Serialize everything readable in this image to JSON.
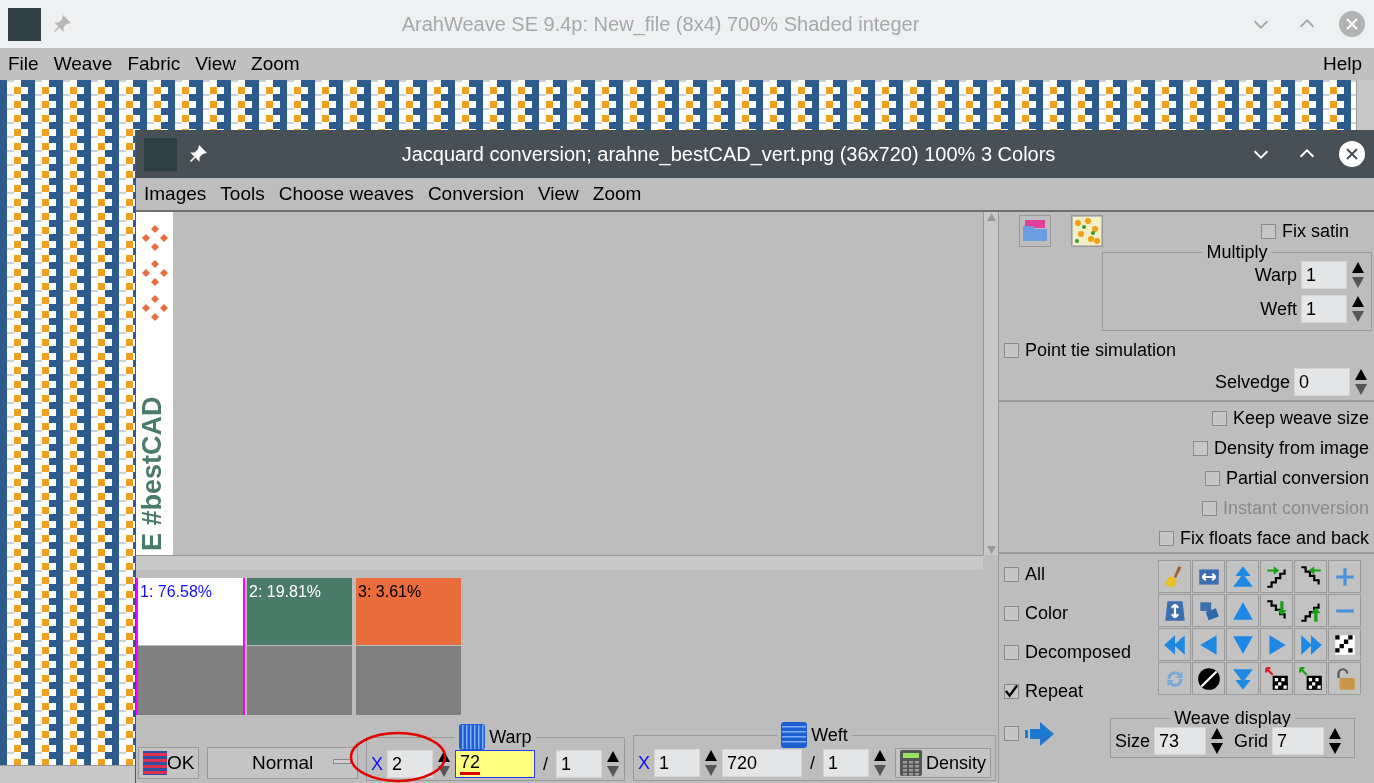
{
  "window": {
    "title": "ArahWeave SE 9.4p: New_file (8x4) 700% Shaded integer"
  },
  "menu": [
    "File",
    "Weave",
    "Fabric",
    "View",
    "Zoom"
  ],
  "help_menu": "Help",
  "dialog": {
    "title": "Jacquard conversion; arahne_bestCAD_vert.png (36x720) 100% 3 Colors",
    "menu": [
      "Images",
      "Tools",
      "Choose weaves",
      "Conversion",
      "View",
      "Zoom"
    ],
    "image_text": "E #bestCAD",
    "palette": [
      {
        "label": "1: 76.58%",
        "color": "#ffffff",
        "selected": true
      },
      {
        "label": "2: 19.81%",
        "color": "#4a7a68",
        "selected": false
      },
      {
        "label": "3: 3.61%",
        "color": "#e86c3c",
        "selected": false
      }
    ],
    "fix_satin": {
      "label": "Fix satin",
      "checked": false
    },
    "multiply": {
      "title": "Multiply",
      "fields": [
        {
          "label": "Warp",
          "value": "1"
        },
        {
          "label": "Weft",
          "value": "1"
        }
      ]
    },
    "point_tie": {
      "label": "Point tie simulation",
      "checked": false
    },
    "selvedge": {
      "label": "Selvedge",
      "value": "0"
    },
    "options": [
      {
        "label": "Keep weave size",
        "checked": false,
        "disabled": false
      },
      {
        "label": "Density from image",
        "checked": false,
        "disabled": false
      },
      {
        "label": "Partial conversion",
        "checked": false,
        "disabled": false
      },
      {
        "label": "Instant conversion",
        "checked": false,
        "disabled": true
      },
      {
        "label": "Fix floats face and back",
        "checked": false,
        "disabled": false
      }
    ],
    "display_options": [
      {
        "label": "All",
        "checked": false
      },
      {
        "label": "Color",
        "checked": false
      },
      {
        "label": "Decomposed",
        "checked": false
      },
      {
        "label": "Repeat",
        "checked": true
      }
    ],
    "arrow_checkbox": {
      "checked": false
    },
    "weave_display": {
      "title": "Weave display",
      "fields": [
        {
          "label": "Size",
          "value": "73"
        },
        {
          "label": "Grid",
          "value": "7"
        }
      ]
    },
    "ok": "OK",
    "mode": "Normal",
    "warp": {
      "title": "Warp",
      "x_label": "X",
      "repeat": "2",
      "value": "72",
      "slash": "/",
      "divisor": "1",
      "highlighted": true
    },
    "weft": {
      "title": "Weft",
      "x_label": "X",
      "repeat": "1",
      "value": "720",
      "slash": "/",
      "divisor": "1",
      "highlighted": false
    },
    "density": "Density"
  }
}
